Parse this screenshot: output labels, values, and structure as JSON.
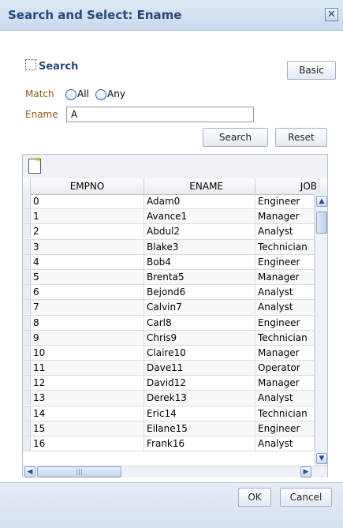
{
  "dialog": {
    "title": "Search and Select: Ename",
    "close_glyph": "✕"
  },
  "search": {
    "header": "Search",
    "basic_label": "Basic",
    "match_label": "Match",
    "match_options": [
      "All",
      "Any"
    ],
    "match_selected": "",
    "ename_label": "Ename",
    "ename_value": "A",
    "search_label": "Search",
    "reset_label": "Reset"
  },
  "table": {
    "columns": [
      "EMPNO",
      "ENAME",
      "JOB"
    ],
    "rows": [
      [
        "0",
        "Adam0",
        "Engineer"
      ],
      [
        "1",
        "Avance1",
        "Manager"
      ],
      [
        "2",
        "Abdul2",
        "Analyst"
      ],
      [
        "3",
        "Blake3",
        "Technician"
      ],
      [
        "4",
        "Bob4",
        "Engineer"
      ],
      [
        "5",
        "Brenta5",
        "Manager"
      ],
      [
        "6",
        "Bejond6",
        "Analyst"
      ],
      [
        "7",
        "Calvin7",
        "Analyst"
      ],
      [
        "8",
        "Carl8",
        "Engineer"
      ],
      [
        "9",
        "Chris9",
        "Technician"
      ],
      [
        "10",
        "Claire10",
        "Manager"
      ],
      [
        "11",
        "Dave11",
        "Operator"
      ],
      [
        "12",
        "David12",
        "Manager"
      ],
      [
        "13",
        "Derek13",
        "Analyst"
      ],
      [
        "14",
        "Eric14",
        "Technician"
      ],
      [
        "15",
        "Eilane15",
        "Engineer"
      ],
      [
        "16",
        "Frank16",
        "Analyst"
      ]
    ]
  },
  "footer": {
    "ok_label": "OK",
    "cancel_label": "Cancel"
  }
}
